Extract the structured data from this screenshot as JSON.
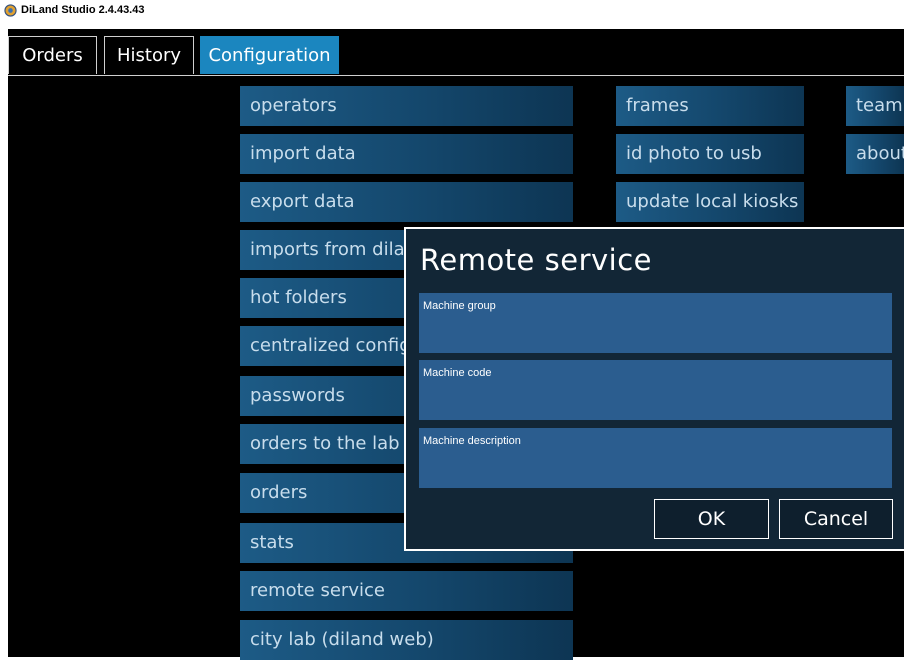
{
  "window": {
    "title": "DiLand Studio 2.4.43.43",
    "icon": "diland-app-icon"
  },
  "tabs": [
    {
      "label": "Orders",
      "active": false
    },
    {
      "label": "History",
      "active": false
    },
    {
      "label": "Configuration",
      "active": true
    }
  ],
  "menu": {
    "col1": [
      "operators",
      "import data",
      "export data",
      "imports from dila",
      "hot folders",
      "centralized config",
      "passwords",
      "orders to the lab",
      "orders",
      "stats",
      "remote service",
      "city lab (diland web)"
    ],
    "col2": [
      "frames",
      "id photo to usb",
      "update local kiosks"
    ],
    "col3": [
      "team",
      "about"
    ]
  },
  "dialog": {
    "title": "Remote service",
    "fields": [
      {
        "label": "Machine group",
        "value": ""
      },
      {
        "label": "Machine code",
        "value": ""
      },
      {
        "label": "Machine description",
        "value": ""
      }
    ],
    "ok_label": "OK",
    "cancel_label": "Cancel"
  },
  "colors": {
    "accent": "#1b86bf",
    "tile": "#14476c",
    "dialog_bg": "#122636",
    "field_bg": "#2b5d8f"
  }
}
